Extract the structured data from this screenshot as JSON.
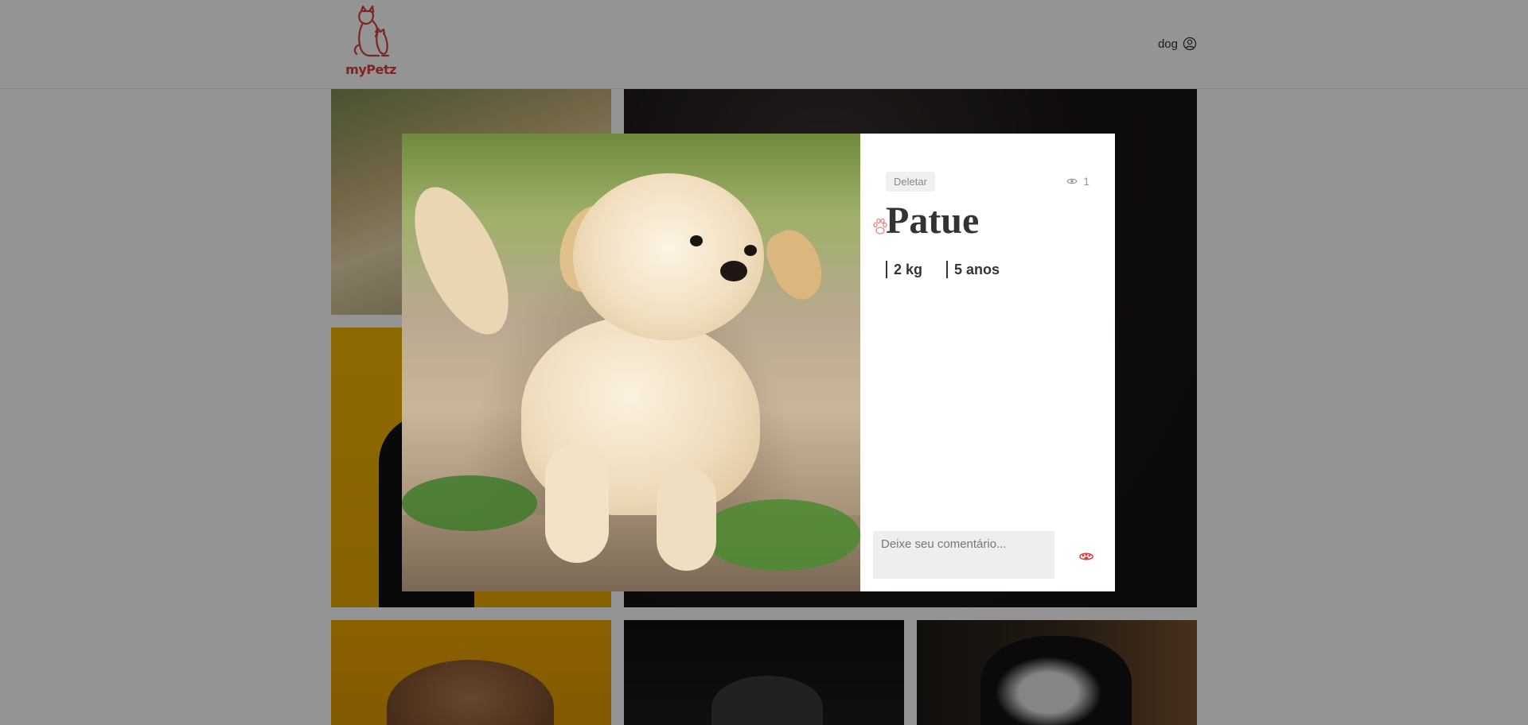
{
  "header": {
    "logo_text": "myPetz",
    "user": {
      "name": "dog",
      "icon": "user-circle-icon"
    }
  },
  "feed": {
    "tiles": [
      "puppy-on-grass",
      "dark-dog",
      "black-dog-yellow-bg",
      "saluki-yellow-bg",
      "dark-dog-2",
      "boston-terrier"
    ]
  },
  "modal": {
    "delete_label": "Deletar",
    "views_icon": "eye-icon",
    "views_count": "1",
    "pet_name": "Patue",
    "weight": "2 kg",
    "age": "5 anos",
    "comment_placeholder": "Deixe seu comentário...",
    "send_icon": "paw-icon"
  },
  "colors": {
    "brand": "#d4423e",
    "overlay": "rgba(0,0,0,0.42)",
    "panel_bg": "#ffffff"
  }
}
